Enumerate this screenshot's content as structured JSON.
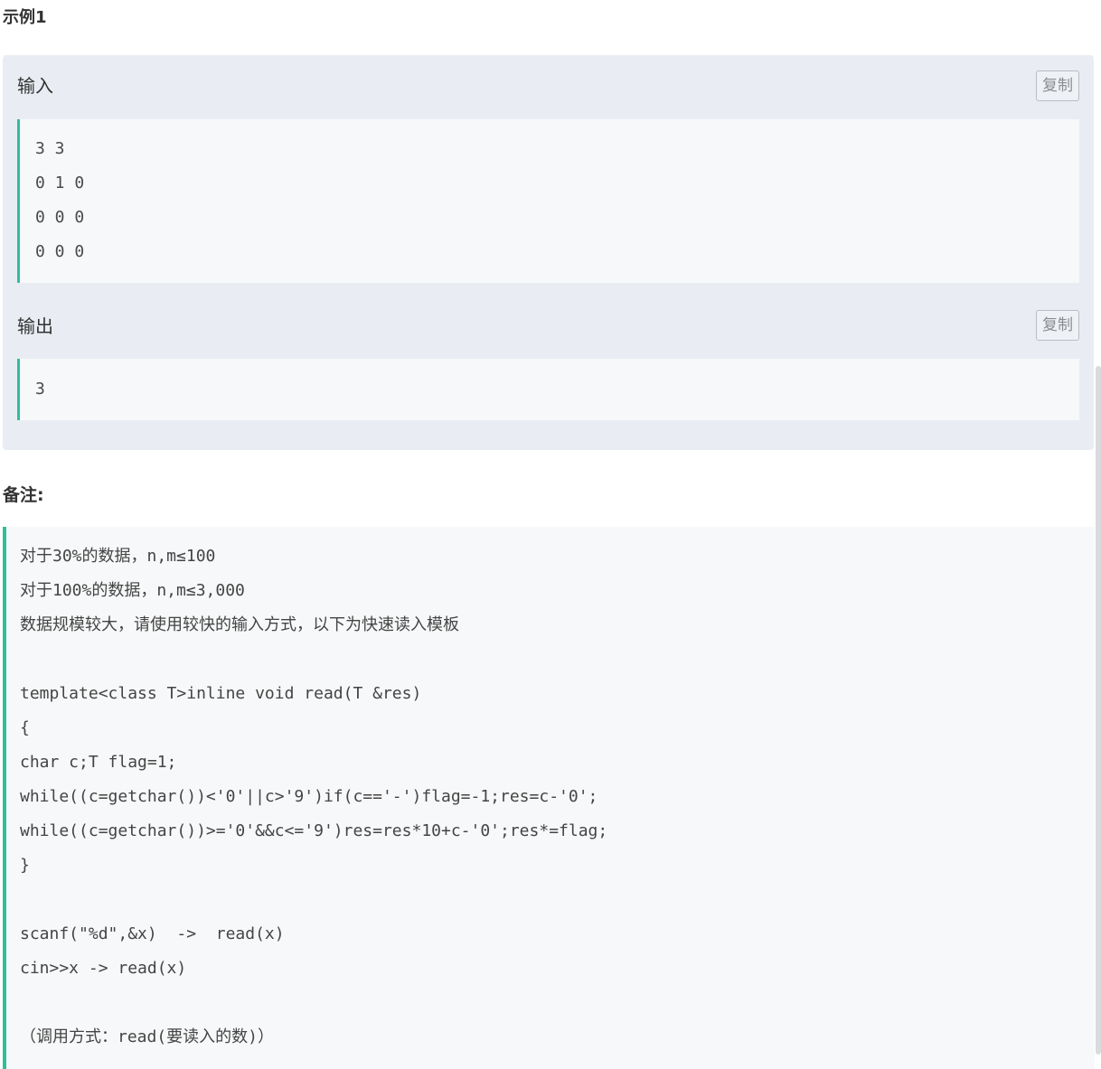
{
  "example": {
    "heading": "示例1",
    "input_label": "输入",
    "output_label": "输出",
    "copy_label": "复制",
    "input_lines": [
      "3 3",
      "0 1 0",
      "0 0 0",
      "0 0 0"
    ],
    "output_lines": [
      "3"
    ]
  },
  "remark": {
    "heading": "备注:",
    "lines": [
      "对于30%的数据，n,m≤100",
      "对于100%的数据，n,m≤3,000",
      "数据规模较大，请使用较快的输入方式，以下为快速读入模板",
      "",
      "template<class T>inline void read(T &res)",
      "{",
      "char c;T flag=1;",
      "while((c=getchar())<'0'||c>'9')if(c=='-')flag=-1;res=c-'0';",
      "while((c=getchar())>='0'&&c<='9')res=res*10+c-'0';res*=flag;",
      "}",
      "",
      "scanf(\"%d\",&x)  ->  read(x)",
      "cin>>x -> read(x)",
      "",
      "（调用方式：read(要读入的数)）"
    ]
  },
  "colors": {
    "accent": "#2ebf9b",
    "panel_bg": "#e9edf3",
    "code_bg": "#f7f8f9"
  }
}
